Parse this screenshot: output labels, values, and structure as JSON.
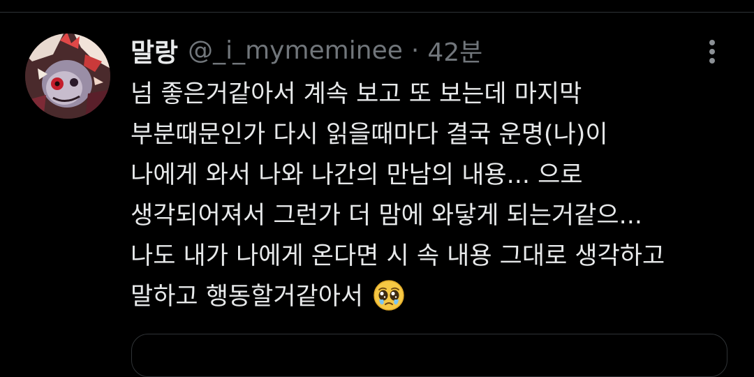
{
  "tweet": {
    "author": {
      "display_name": "말랑",
      "handle": "@_i_mymeminee",
      "separator": "·",
      "timestamp": "42분"
    },
    "text_lines": [
      "넘 좋은거같아서 계속 보고 또 보는데 마지막",
      "부분때문인가 다시 읽을때마다 결국 운명(나)이",
      "나에게 와서 나와 나간의 만남의 내용... 으로",
      "생각되어져서 그런가 더 맘에 와닿게 되는거같으...",
      "나도 내가 나에게 온다면 시 속 내용 그대로 생각하고",
      "말하고 행동할거같아서"
    ],
    "emoji": "pleading-face-emoji",
    "more_icon": "more-vertical-icon"
  },
  "colors": {
    "background": "#000000",
    "primary_text": "#e7e9ea",
    "secondary_text": "#71767b",
    "divider": "#2f3336"
  }
}
